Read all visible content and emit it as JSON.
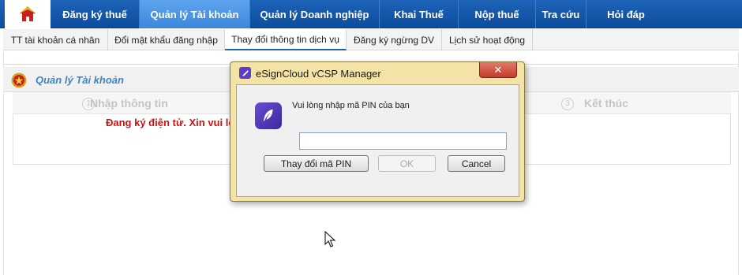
{
  "topnav": {
    "items": [
      {
        "label": "Đăng ký thuế",
        "active": false
      },
      {
        "label": "Quản lý Tài khoản",
        "active": true
      },
      {
        "label": "Quản lý Doanh nghiệp",
        "active": false
      },
      {
        "label": "Khai Thuế",
        "active": false
      },
      {
        "label": "Nộp thuế",
        "active": false
      },
      {
        "label": "Tra cứu",
        "active": false
      },
      {
        "label": "Hỏi đáp",
        "active": false
      }
    ],
    "home_icon": "home-icon",
    "accent": "#0d4c9c",
    "active_bg": "#4c96e5"
  },
  "subnav": {
    "items": [
      {
        "label": "TT tài khoản cá nhân",
        "active": false
      },
      {
        "label": "Đổi mật khẩu đăng nhập",
        "active": false
      },
      {
        "label": "Thay đổi thông tin dịch vụ",
        "active": true
      },
      {
        "label": "Đăng ký ngừng DV",
        "active": false
      },
      {
        "label": "Lịch sử hoạt động",
        "active": false
      }
    ]
  },
  "section": {
    "title": "Quản lý Tài khoản",
    "emblem_icon": "national-emblem-icon",
    "title_color": "#3a86c8"
  },
  "steps": [
    {
      "number": "1",
      "label": "Nhập thông tin"
    },
    {
      "number": "3",
      "label": "Kết thúc"
    }
  ],
  "warning_text": "Đang ký điện tử. Xin vui lòng",
  "warning_color": "#cc1111",
  "dialog": {
    "title": "eSignCloud vCSP Manager",
    "close_label": "✕",
    "prompt": "Vui lòng nhập mã PIN của bạn",
    "pin_value": "",
    "buttons": {
      "change_pin": "Thay đổi mã PIN",
      "ok": "OK",
      "cancel": "Cancel"
    },
    "frame_color": "#f3e3a6",
    "app_icon": "feather-pen-icon"
  },
  "cursor_icon": "mouse-pointer-icon"
}
